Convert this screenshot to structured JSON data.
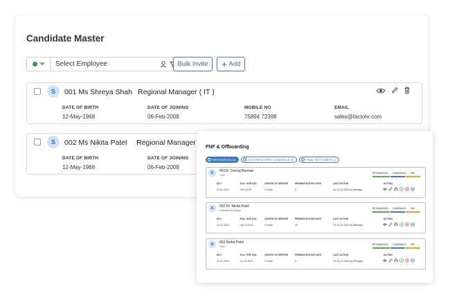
{
  "page": {
    "title": "Candidate Master"
  },
  "toolbar": {
    "employee_placeholder": "Select Employee",
    "bulk_invite_label": "Bulk Invite",
    "add_label": "Add",
    "status_color": "#2ea043"
  },
  "field_labels": {
    "dob": "DATE OF BIRTH",
    "doj": "DATE OF JOINING",
    "mobile": "MOBILE NO",
    "email": "EMAIL"
  },
  "candidates": [
    {
      "avatar": "S",
      "name": "001  Ms Shreya Shah",
      "role": "Regional Manager ( IT )",
      "dob": "12-May-1968",
      "doj": "06-Feb-2008",
      "mobile": "75894 72398",
      "email": "sales@factohr.com"
    },
    {
      "avatar": "S",
      "name": "002 Ms Nikita Patel",
      "role": "Regional Manager (",
      "dob": "12-May-1968",
      "doj": "06-Feb-2008"
    }
  ],
  "fnf": {
    "title": "FNF & Offboarding",
    "tabs": [
      "RESIGNATION (3)",
      "EXIT EMPLOYEES CLEARANCE (3)",
      "FINAL SETTLEMENT ()"
    ],
    "stages": [
      "RESIGNATION",
      "CLEARANCE",
      "FNF"
    ],
    "headers": {
      "doj": "DOJ",
      "dol": "DOL / EXP DOL",
      "length": "LENGTH OF SERVICE",
      "notice": "PENDING NOTICE DAYS",
      "last": "LAST ACTION",
      "action": "ACTION"
    },
    "items": [
      {
        "avatar": "D",
        "name": "001Dr. Devraj Barman",
        "role": "Tutor",
        "doj": "01-01-2012",
        "dol": "30-9-2015",
        "length": "2 Years",
        "notice": "0",
        "last": "On 24-12-2013 by Manager"
      },
      {
        "avatar": "N",
        "name": "002 Dr. Nikita Patel",
        "role": "Software Developer",
        "doj": "01-01-2012",
        "dol": "15-12-2013",
        "length": "3 Years",
        "notice": "15",
        "last": "On 31-12-2013 by Manager"
      },
      {
        "avatar": "N",
        "name": "003 Nisha Patel",
        "role": "Tutor",
        "doj": "01-01-2012",
        "dol": "31-12-2013",
        "length": "2 Years",
        "notice": "0",
        "last": "On 31-12-2013 by Manager"
      }
    ]
  },
  "colors": {
    "accent": "#3b79c9",
    "stage_green": "#4caf50",
    "stage_blue": "#3b79c9",
    "stage_orange": "#f0a020"
  }
}
